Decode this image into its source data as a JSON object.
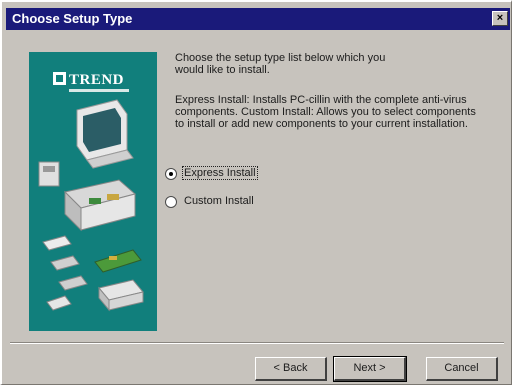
{
  "window": {
    "title": "Choose Setup Type",
    "close_glyph": "×",
    "titlebar_color": "#1a1a7a",
    "face_color": "#c7c3bd"
  },
  "graphic": {
    "logo_text": "TREND",
    "panel_color": "#117f7c"
  },
  "content": {
    "intro": "Choose the setup type list below which you would like to install.",
    "description": "Express Install: Installs PC-cillin with the complete anti-virus components. Custom Install: Allows you to select components to install or add new components to your current installation."
  },
  "options": [
    {
      "label": "Express Install",
      "selected": true
    },
    {
      "label": "Custom Install",
      "selected": false
    }
  ],
  "buttons": {
    "back": "< Back",
    "next": "Next >",
    "cancel": "Cancel"
  }
}
